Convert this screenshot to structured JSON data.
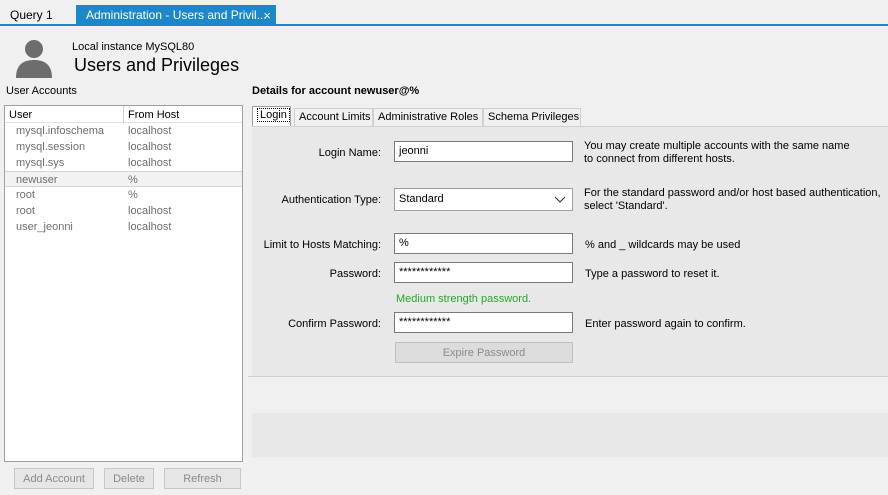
{
  "tabs": [
    {
      "label": "Query 1"
    },
    {
      "label": "Administration - Users and Privil...",
      "close": "×"
    }
  ],
  "header": {
    "instance": "Local instance MySQL80",
    "title": "Users and Privileges"
  },
  "user_accounts": {
    "title": "User Accounts",
    "columns": [
      "User",
      "From Host"
    ],
    "rows": [
      {
        "user": "mysql.infoschema",
        "host": "localhost"
      },
      {
        "user": "mysql.session",
        "host": "localhost"
      },
      {
        "user": "mysql.sys",
        "host": "localhost"
      },
      {
        "user": "newuser",
        "host": "%"
      },
      {
        "user": "root",
        "host": "%"
      },
      {
        "user": "root",
        "host": "localhost"
      },
      {
        "user": "user_jeonni",
        "host": "localhost"
      }
    ],
    "buttons": {
      "add": "Add Account",
      "delete": "Delete",
      "refresh": "Refresh"
    }
  },
  "details": {
    "title": "Details for account newuser@%",
    "tabs": [
      "Login",
      "Account Limits",
      "Administrative Roles",
      "Schema Privileges"
    ],
    "login_name": {
      "label": "Login Name:",
      "value": "jeonni",
      "hint": "You may create multiple accounts with the same name\nto connect from different hosts."
    },
    "auth_type": {
      "label": "Authentication Type:",
      "value": "Standard",
      "hint": "For the standard password and/or host based authentication,\nselect 'Standard'."
    },
    "hosts": {
      "label": "Limit to Hosts Matching:",
      "value": "%",
      "hint": "% and _ wildcards may be used"
    },
    "password": {
      "label": "Password:",
      "value": "************",
      "hint": "Type a password to reset it.",
      "strength": "Medium strength password."
    },
    "confirm": {
      "label": "Confirm Password:",
      "value": "************",
      "hint": "Enter password again to confirm."
    },
    "expire_button": "Expire Password"
  },
  "colors": {
    "accent": "#1c87c9",
    "strength": "#2aa52a"
  },
  "icons": {
    "avatar": "user-avatar-icon",
    "close": "close-icon",
    "dropdown": "chevron-down-icon"
  }
}
